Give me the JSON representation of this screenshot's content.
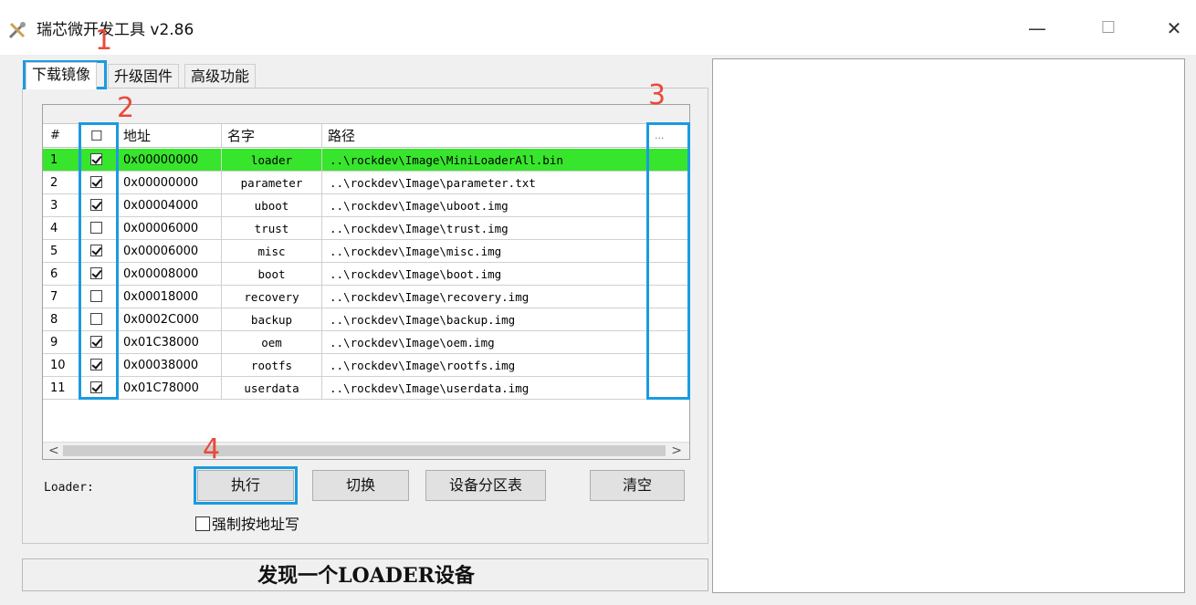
{
  "window": {
    "title": "瑞芯微开发工具 v2.86",
    "minimize": "—",
    "maximize": "☐",
    "close": "✕"
  },
  "tabs": [
    "下载镜像",
    "升级固件",
    "高级功能"
  ],
  "table": {
    "headers": {
      "num": "#",
      "check": "☐",
      "address": "地址",
      "name": "名字",
      "path": "路径",
      "browse": "..."
    },
    "rows": [
      {
        "num": "1",
        "checked": true,
        "address": "0x00000000",
        "name": "loader",
        "path": "..\\rockdev\\Image\\MiniLoaderAll.bin",
        "selected": true
      },
      {
        "num": "2",
        "checked": true,
        "address": "0x00000000",
        "name": "parameter",
        "path": "..\\rockdev\\Image\\parameter.txt"
      },
      {
        "num": "3",
        "checked": true,
        "address": "0x00004000",
        "name": "uboot",
        "path": "..\\rockdev\\Image\\uboot.img"
      },
      {
        "num": "4",
        "checked": false,
        "address": "0x00006000",
        "name": "trust",
        "path": "..\\rockdev\\Image\\trust.img"
      },
      {
        "num": "5",
        "checked": true,
        "address": "0x00006000",
        "name": "misc",
        "path": "..\\rockdev\\Image\\misc.img"
      },
      {
        "num": "6",
        "checked": true,
        "address": "0x00008000",
        "name": "boot",
        "path": "..\\rockdev\\Image\\boot.img"
      },
      {
        "num": "7",
        "checked": false,
        "address": "0x00018000",
        "name": "recovery",
        "path": "..\\rockdev\\Image\\recovery.img"
      },
      {
        "num": "8",
        "checked": false,
        "address": "0x0002C000",
        "name": "backup",
        "path": "..\\rockdev\\Image\\backup.img"
      },
      {
        "num": "9",
        "checked": true,
        "address": "0x01C38000",
        "name": "oem",
        "path": "..\\rockdev\\Image\\oem.img"
      },
      {
        "num": "10",
        "checked": true,
        "address": "0x00038000",
        "name": "rootfs",
        "path": "..\\rockdev\\Image\\rootfs.img"
      },
      {
        "num": "11",
        "checked": true,
        "address": "0x01C78000",
        "name": "userdata",
        "path": "..\\rockdev\\Image\\userdata.img"
      }
    ]
  },
  "scroll": {
    "left": "<",
    "right": ">"
  },
  "loader_label": "Loader:",
  "buttons": {
    "run": "执行",
    "switch": "切换",
    "partition": "设备分区表",
    "clear": "清空"
  },
  "force_write": "强制按地址写",
  "status": "发现一个LOADER设备",
  "annotations": [
    "1",
    "2",
    "3",
    "4"
  ],
  "colors": {
    "selected_row": "#37e52c",
    "annotation_box": "#1a9be0",
    "annotation_number": "#e84a3a"
  }
}
